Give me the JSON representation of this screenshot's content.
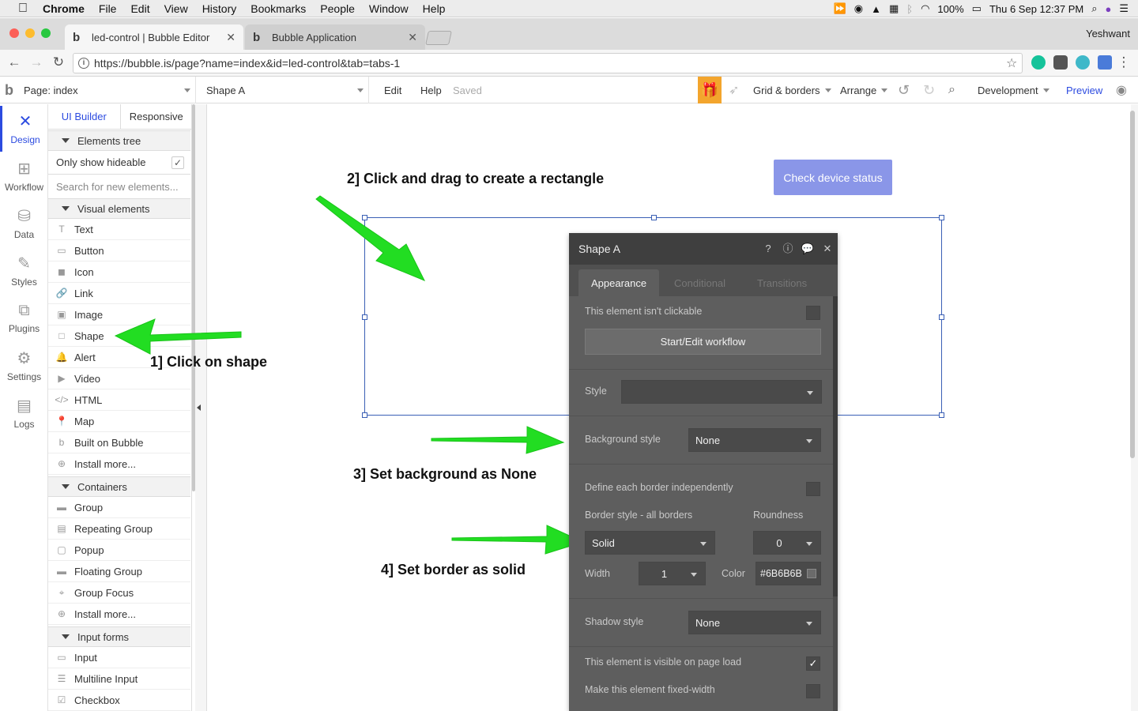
{
  "menubar": {
    "app": "Chrome",
    "items": [
      "File",
      "Edit",
      "View",
      "History",
      "Bookmarks",
      "People",
      "Window",
      "Help"
    ],
    "battery": "100%",
    "datetime": "Thu 6 Sep  12:37 PM"
  },
  "browser": {
    "tabs": [
      {
        "label": "led-control | Bubble Editor",
        "favicon": "b"
      },
      {
        "label": "Bubble Application",
        "favicon": "b"
      }
    ],
    "profile": "Yeshwant",
    "url": "https://bubble.is/page?name=index&id=led-control&tab=tabs-1"
  },
  "toolbar": {
    "logo": "b",
    "page_select": "Page: index",
    "element_select": "Shape A",
    "edit": "Edit",
    "help": "Help",
    "saved": "Saved",
    "grid": "Grid & borders",
    "arrange": "Arrange",
    "env": "Development",
    "preview": "Preview"
  },
  "rail": {
    "items": [
      {
        "label": "Design",
        "icon": "design-icon",
        "active": true
      },
      {
        "label": "Workflow",
        "icon": "workflow-icon"
      },
      {
        "label": "Data",
        "icon": "data-icon"
      },
      {
        "label": "Styles",
        "icon": "styles-icon"
      },
      {
        "label": "Plugins",
        "icon": "plugins-icon"
      },
      {
        "label": "Settings",
        "icon": "settings-icon"
      },
      {
        "label": "Logs",
        "icon": "logs-icon"
      }
    ]
  },
  "panel": {
    "tabs": [
      "UI Builder",
      "Responsive"
    ],
    "elements_tree": "Elements tree",
    "only_hideable": "Only show hideable",
    "search_placeholder": "Search for new elements...",
    "visual_header": "Visual elements",
    "visual": [
      {
        "label": "Text",
        "glyph": "T"
      },
      {
        "label": "Button",
        "glyph": "▭"
      },
      {
        "label": "Icon",
        "glyph": "◼"
      },
      {
        "label": "Link",
        "glyph": "🔗"
      },
      {
        "label": "Image",
        "glyph": "▣"
      },
      {
        "label": "Shape",
        "glyph": "□"
      },
      {
        "label": "Alert",
        "glyph": "🔔"
      },
      {
        "label": "Video",
        "glyph": "▶"
      },
      {
        "label": "HTML",
        "glyph": "</>"
      },
      {
        "label": "Map",
        "glyph": "📍"
      },
      {
        "label": "Built on Bubble",
        "glyph": "b"
      },
      {
        "label": "Install more...",
        "glyph": "⊕"
      }
    ],
    "containers_header": "Containers",
    "containers": [
      {
        "label": "Group",
        "glyph": "▬"
      },
      {
        "label": "Repeating Group",
        "glyph": "▤"
      },
      {
        "label": "Popup",
        "glyph": "▢"
      },
      {
        "label": "Floating Group",
        "glyph": "▬"
      },
      {
        "label": "Group Focus",
        "glyph": "⌖"
      },
      {
        "label": "Install more...",
        "glyph": "⊕"
      }
    ],
    "inputs_header": "Input forms",
    "inputs": [
      {
        "label": "Input",
        "glyph": "▭"
      },
      {
        "label": "Multiline Input",
        "glyph": "☰"
      },
      {
        "label": "Checkbox",
        "glyph": "☑"
      }
    ]
  },
  "canvas": {
    "button": "Check device status"
  },
  "annotations": {
    "a1": "1] Click on shape",
    "a2": "2] Click and drag to create a rectangle",
    "a3": "3] Set background as None",
    "a4": "4] Set border as solid",
    "arrow_color": "#22dd22"
  },
  "property_editor": {
    "title": "Shape A",
    "tabs": [
      "Appearance",
      "Conditional",
      "Transitions"
    ],
    "not_clickable": "This element isn't clickable",
    "workflow_btn": "Start/Edit workflow",
    "style_label": "Style",
    "style_value": "",
    "bg_label": "Background style",
    "bg_value": "None",
    "border_indep": "Define each border independently",
    "border_label": "Border style - all borders",
    "roundness_label": "Roundness",
    "border_value": "Solid",
    "roundness_value": "0",
    "width_label": "Width",
    "width_value": "1",
    "color_label": "Color",
    "color_value": "#6B6B6B",
    "shadow_label": "Shadow style",
    "shadow_value": "None",
    "visible_label": "This element is visible on page load",
    "fixed_width_label": "Make this element fixed-width"
  }
}
